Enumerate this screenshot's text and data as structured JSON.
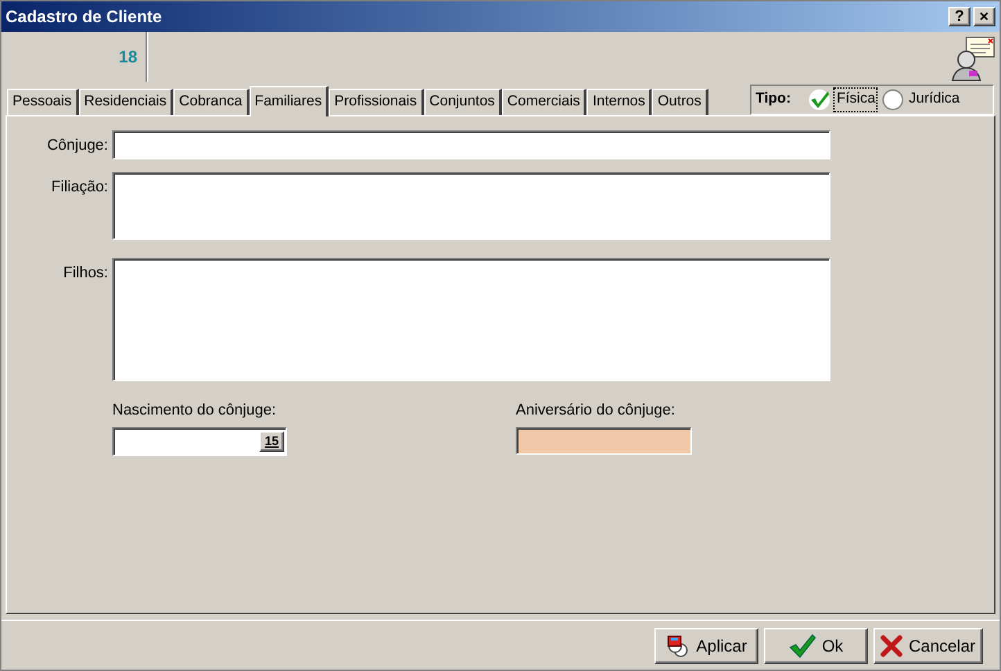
{
  "window": {
    "title": "Cadastro de Cliente",
    "buttons": [
      {
        "kind": "help",
        "label": "?"
      },
      {
        "kind": "close",
        "label": "✕"
      }
    ]
  },
  "header": {
    "code": "18"
  },
  "tabs": [
    {
      "label": "Pessoais",
      "selected": false
    },
    {
      "label": "Residenciais",
      "selected": false
    },
    {
      "label": "Cobranca",
      "selected": false
    },
    {
      "label": "Familiares",
      "selected": true
    },
    {
      "label": "Profissionais",
      "selected": false
    },
    {
      "label": "Conjuntos",
      "selected": false
    },
    {
      "label": "Comerciais",
      "selected": false
    },
    {
      "label": "Internos",
      "selected": false
    },
    {
      "label": "Outros",
      "selected": false
    }
  ],
  "tipo": {
    "label": "Tipo:",
    "options": [
      {
        "label": "Física",
        "selected": true
      },
      {
        "label": "Jurídica",
        "selected": false
      }
    ]
  },
  "fields": [
    {
      "label": "Cônjuge:",
      "kind": "single"
    },
    {
      "label": "Filiação:",
      "kind": "medium"
    },
    {
      "label": "Filhos:",
      "kind": "large"
    }
  ],
  "dates": [
    {
      "label": "Nascimento do cônjuge:",
      "kind": "date"
    },
    {
      "label": "Aniversário do cônjuge:",
      "kind": "readonly"
    }
  ],
  "date_button": "15",
  "buttons": [
    {
      "label": "Aplicar",
      "kind": "apply"
    },
    {
      "label": "Ok",
      "kind": "ok"
    },
    {
      "label": "Cancelar",
      "kind": "cancel"
    }
  ]
}
